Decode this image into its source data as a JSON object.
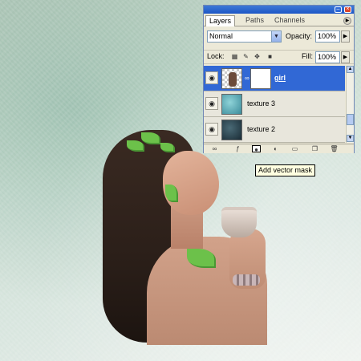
{
  "panel": {
    "tabs": [
      "Layers",
      "Paths",
      "Channels"
    ],
    "blend_mode": "Normal",
    "opacity_label": "Opacity:",
    "opacity_value": "100%",
    "lock_label": "Lock:",
    "fill_label": "Fill:",
    "fill_value": "100%",
    "layers": [
      {
        "name": "girl",
        "selected": true,
        "visible": true,
        "has_mask": true
      },
      {
        "name": "texture 3",
        "selected": false,
        "visible": true
      },
      {
        "name": "texture 2",
        "selected": false,
        "visible": true
      }
    ]
  },
  "tooltip": "Add vector mask",
  "colors": {
    "title_bar": "#1d56c6",
    "selection": "#3168d5",
    "panel_bg": "#ece9d8",
    "tooltip_bg": "#ffffe1"
  },
  "icons": {
    "eye": "eye-icon",
    "link": "chain-link-icon",
    "lock_transparent": "checker-lock-icon",
    "lock_paint": "brush-lock-icon",
    "lock_move": "move-lock-icon",
    "lock_all": "padlock-icon",
    "footer": [
      "link-layers-icon",
      "layer-style-icon",
      "add-mask-icon",
      "adjustment-layer-icon",
      "new-group-icon",
      "new-layer-icon",
      "delete-layer-icon"
    ]
  }
}
